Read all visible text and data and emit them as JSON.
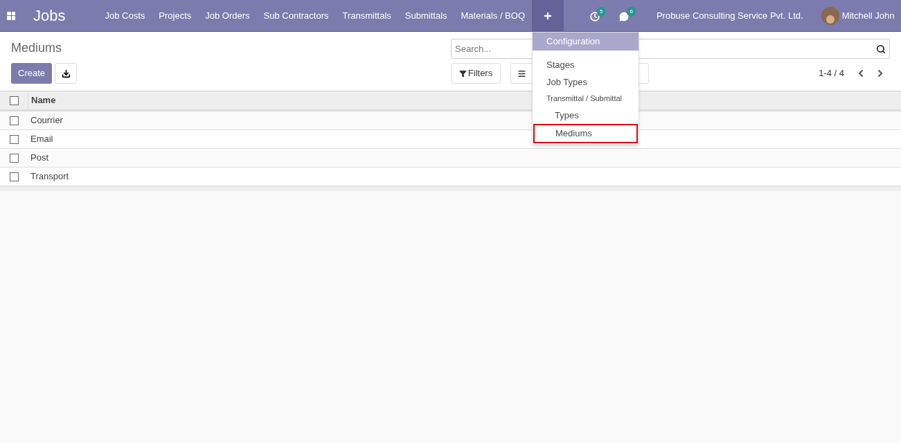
{
  "navbar": {
    "app_title": "Jobs",
    "menu": [
      {
        "label": "Job Costs"
      },
      {
        "label": "Projects"
      },
      {
        "label": "Job Orders"
      },
      {
        "label": "Sub Contractors"
      },
      {
        "label": "Transmittals"
      },
      {
        "label": "Submittals"
      },
      {
        "label": "Materials / BOQ"
      }
    ],
    "activities_count": "5",
    "messages_count": "6",
    "company": "Probuse Consulting Service Pvt. Ltd.",
    "user": "Mitchell John"
  },
  "dropdown": [
    {
      "kind": "header",
      "label": "Configuration",
      "highlighted": false
    },
    {
      "kind": "item",
      "label": "Stages",
      "highlighted": false
    },
    {
      "kind": "item",
      "label": "Job Types",
      "highlighted": false
    },
    {
      "kind": "section",
      "label": "Transmittal / Submittal",
      "highlighted": false
    },
    {
      "kind": "subitem",
      "label": "Types",
      "highlighted": false
    },
    {
      "kind": "subitem",
      "label": "Mediums",
      "highlighted": true
    }
  ],
  "control_panel": {
    "title": "Mediums",
    "create_label": "Create",
    "search_placeholder": "Search...",
    "filters_label": "Filters",
    "pager": "1-4 / 4"
  },
  "table": {
    "all_checked": false,
    "columns": [
      "Name"
    ],
    "rows": [
      {
        "name": "Courrier",
        "checked": false
      },
      {
        "name": "Email",
        "checked": false
      },
      {
        "name": "Post",
        "checked": false
      },
      {
        "name": "Transport",
        "checked": false
      }
    ]
  }
}
